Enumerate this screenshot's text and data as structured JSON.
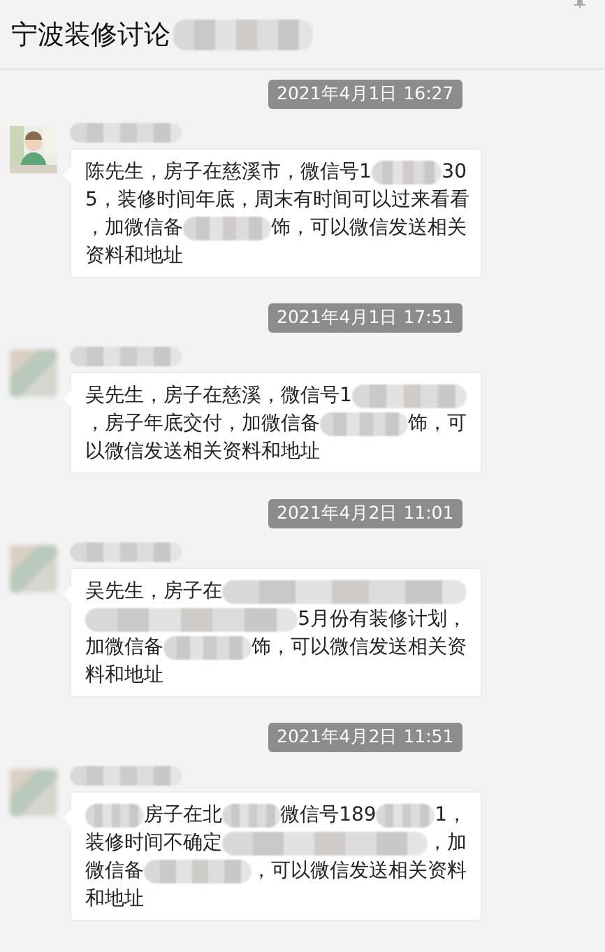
{
  "header": {
    "title": "宁波装修讨论",
    "title_redacted": true
  },
  "messages": [
    {
      "time": "2021年4月1日 16:27",
      "avatar": {
        "kind": "picture"
      },
      "sender_redacted": true,
      "lines": [
        [
          {
            "kind": "text",
            "text": "陈先生，房子在慈溪市，微信号1"
          },
          {
            "kind": "blur"
          },
          {
            "kind": "text",
            "text": "30"
          }
        ],
        [
          {
            "kind": "text",
            "text": "5，装修时间年底，周末有时间可以过来看看"
          }
        ],
        [
          {
            "kind": "text",
            "text": "，加微信备"
          },
          {
            "kind": "blur"
          },
          {
            "kind": "text",
            "text": "饰，可以微信发送相关"
          }
        ],
        [
          {
            "kind": "text",
            "text": "资料和地址"
          }
        ]
      ]
    },
    {
      "time": "2021年4月1日 17:51",
      "avatar": {
        "kind": "blur"
      },
      "sender_redacted": true,
      "lines": [
        [
          {
            "kind": "text",
            "text": "吴先生，房子在慈溪，微信号1"
          },
          {
            "kind": "blur"
          }
        ],
        [
          {
            "kind": "text",
            "text": "，房子年底交付，加微信备"
          },
          {
            "kind": "blur"
          },
          {
            "kind": "text",
            "text": "饰，可"
          }
        ],
        [
          {
            "kind": "text",
            "text": "以微信发送相关资料和地址"
          }
        ]
      ]
    },
    {
      "time": "2021年4月2日 11:01",
      "avatar": {
        "kind": "blur"
      },
      "sender_redacted": true,
      "lines": [
        [
          {
            "kind": "text",
            "text": "吴先生，房子在"
          },
          {
            "kind": "blur"
          }
        ],
        [
          {
            "kind": "blur"
          },
          {
            "kind": "text",
            "text": "5月份有装修计划，"
          }
        ],
        [
          {
            "kind": "text",
            "text": "加微信备"
          },
          {
            "kind": "blur"
          },
          {
            "kind": "text",
            "text": "饰，可以微信发送相关资"
          }
        ],
        [
          {
            "kind": "text",
            "text": "料和地址"
          }
        ]
      ]
    },
    {
      "time": "2021年4月2日 11:51",
      "avatar": {
        "kind": "blur"
      },
      "sender_redacted": true,
      "lines": [
        [
          {
            "kind": "blur"
          },
          {
            "kind": "text",
            "text": "房子在北"
          },
          {
            "kind": "blur"
          },
          {
            "kind": "text",
            "text": "微信号189"
          },
          {
            "kind": "blur"
          },
          {
            "kind": "text",
            "text": "1，"
          }
        ],
        [
          {
            "kind": "text",
            "text": "装修时间不确定"
          },
          {
            "kind": "blur"
          },
          {
            "kind": "text",
            "text": "，加"
          }
        ],
        [
          {
            "kind": "text",
            "text": "微信备"
          },
          {
            "kind": "blur"
          },
          {
            "kind": "text",
            "text": "，可以微信发送相关资料"
          }
        ],
        [
          {
            "kind": "text",
            "text": "和地址"
          }
        ]
      ]
    }
  ]
}
